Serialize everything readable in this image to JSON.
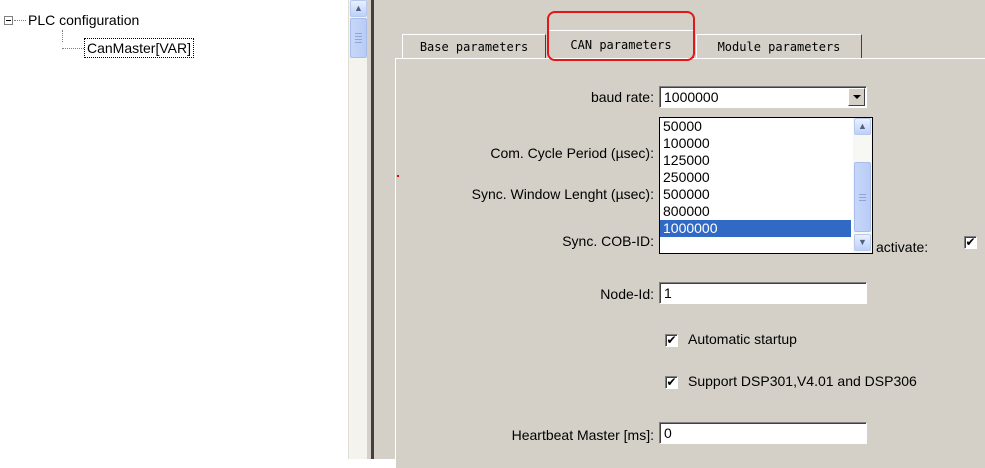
{
  "tree": {
    "root_label": "PLC configuration",
    "child_label": "CanMaster[VAR]"
  },
  "tabs": [
    {
      "label": "Base parameters"
    },
    {
      "label": "CAN parameters"
    },
    {
      "label": "Module parameters"
    }
  ],
  "active_tab": "CAN parameters",
  "form": {
    "baud_rate_label": "baud rate:",
    "baud_rate_value": "1000000",
    "com_cycle_label": "Com. Cycle Period (µsec):",
    "sync_window_label": "Sync. Window Lenght (µsec):",
    "sync_cobid_label": "Sync. COB-ID:",
    "activate_label": "activate:",
    "activate_checked": "✔",
    "node_id_label": "Node-Id:",
    "node_id_value": "1",
    "auto_startup_label": "Automatic startup",
    "auto_startup_checked": "✔",
    "dsp_label": "Support DSP301,V4.01 and DSP306",
    "dsp_checked": "✔",
    "heartbeat_label": "Heartbeat Master [ms]:",
    "heartbeat_value": "0"
  },
  "baud_options": [
    "50000",
    "100000",
    "125000",
    "250000",
    "500000",
    "800000",
    "1000000"
  ],
  "colors": {
    "selection": "#316ac5",
    "highlight_outline": "#e01818",
    "panel": "#d4d0c8"
  }
}
